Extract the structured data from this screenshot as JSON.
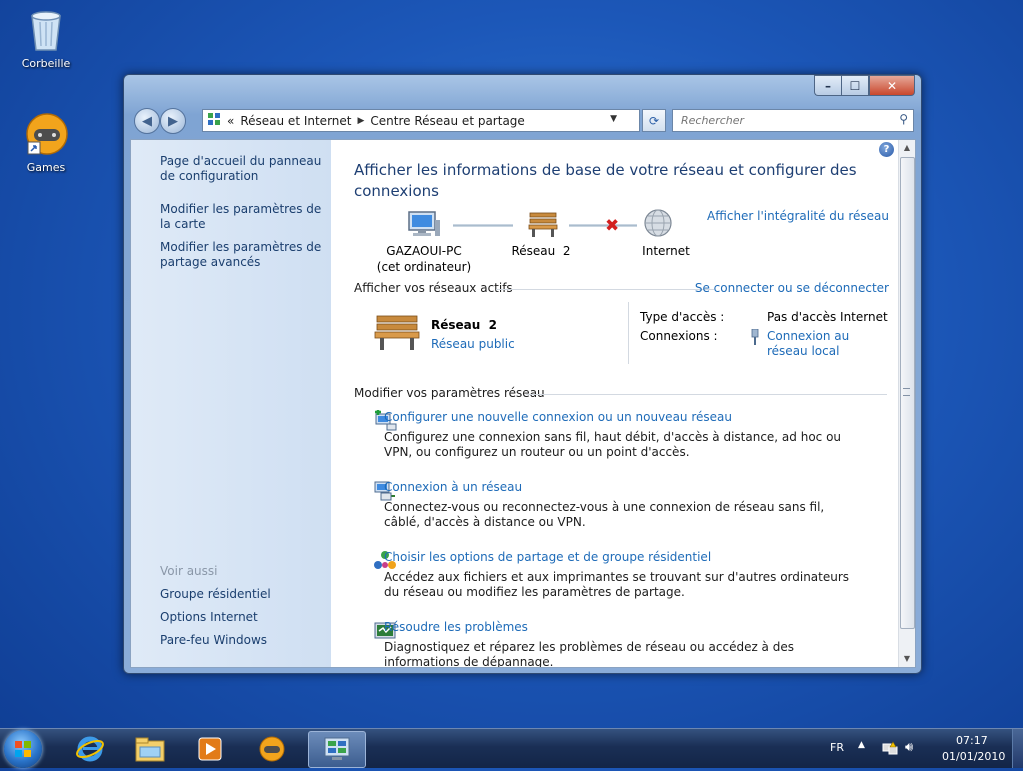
{
  "desktop": {
    "icons": [
      {
        "label": "Corbeille"
      },
      {
        "label": "Games"
      }
    ]
  },
  "window": {
    "controls": {
      "minimize": "–",
      "maximize": "☐",
      "close": "✕"
    },
    "nav": {
      "back": "◀",
      "forward": "▶"
    },
    "address": {
      "prefix": "«",
      "crumbs": [
        "Réseau et Internet",
        "Centre Réseau et partage"
      ],
      "separator": "▶"
    },
    "search": {
      "placeholder": "Rechercher"
    }
  },
  "sidebar": {
    "links": [
      "Page d'accueil du panneau de configuration",
      "Modifier les paramètres de la carte",
      "Modifier les paramètres de partage avancés"
    ],
    "see_also": {
      "heading": "Voir aussi",
      "links": [
        "Groupe résidentiel",
        "Options Internet",
        "Pare-feu Windows"
      ]
    }
  },
  "main": {
    "help": "?",
    "title": "Afficher les informations de base de votre réseau et configurer des connexions",
    "full_map_link": "Afficher l'intégralité du réseau",
    "map": {
      "computer": {
        "name": "GAZAOUI-PC",
        "sub": "(cet ordinateur)"
      },
      "network": {
        "name": "Réseau  2"
      },
      "internet": {
        "name": "Internet"
      }
    },
    "active_networks": {
      "heading": "Afficher vos réseaux actifs",
      "connect_link": "Se connecter ou se déconnecter",
      "network_name": "Réseau  2",
      "network_type": "Réseau public",
      "access_label": "Type d'accès :",
      "access_value": "Pas d'accès Internet",
      "connections_label": "Connexions :",
      "connections_value": "Connexion au réseau local"
    },
    "settings": {
      "heading": "Modifier vos paramètres réseau",
      "tasks": [
        {
          "icon": "new-connection-icon",
          "title": "Configurer une nouvelle connexion ou un nouveau réseau",
          "desc": "Configurez une connexion sans fil, haut débit, d'accès à distance, ad hoc ou VPN, ou configurez un routeur ou un point d'accès."
        },
        {
          "icon": "connect-network-icon",
          "title": "Connexion à un réseau",
          "desc": "Connectez-vous ou reconnectez-vous à une connexion de réseau sans fil, câblé, d'accès à distance ou VPN."
        },
        {
          "icon": "homegroup-icon",
          "title": "Choisir les options de partage et de groupe résidentiel",
          "desc": "Accédez aux fichiers et aux imprimantes se trouvant sur d'autres ordinateurs du réseau ou modifiez les paramètres de partage."
        },
        {
          "icon": "troubleshoot-icon",
          "title": "Résoudre les problèmes",
          "desc": "Diagnostiquez et réparez les problèmes de réseau ou accédez à des informations de dépannage."
        }
      ]
    }
  },
  "taskbar": {
    "items": [
      "internet-explorer-icon",
      "explorer-folder-icon",
      "media-player-icon",
      "games-icon",
      "network-center-icon"
    ],
    "language": "FR",
    "time": "07:17",
    "date": "01/01/2010"
  },
  "colors": {
    "link": "#1e6bb8",
    "title": "#1e3f73",
    "sidebar_link": "#1a3e6e",
    "desktop": "#1c57b8",
    "red_x": "#d21f1f"
  }
}
